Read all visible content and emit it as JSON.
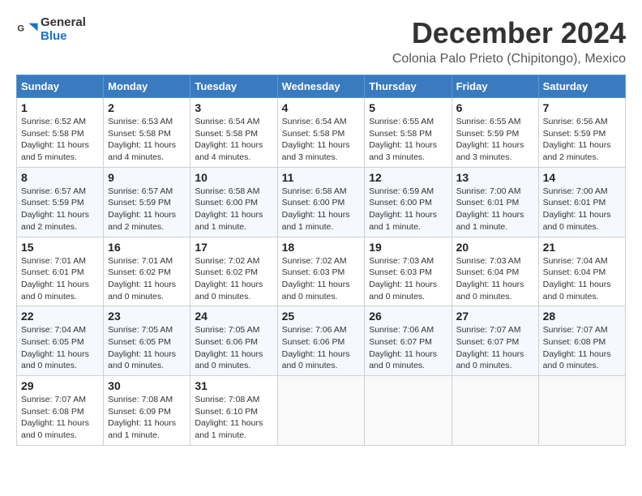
{
  "logo": {
    "text_general": "General",
    "text_blue": "Blue"
  },
  "title": {
    "month": "December 2024",
    "location": "Colonia Palo Prieto (Chipitongo), Mexico"
  },
  "weekdays": [
    "Sunday",
    "Monday",
    "Tuesday",
    "Wednesday",
    "Thursday",
    "Friday",
    "Saturday"
  ],
  "weeks": [
    [
      {
        "day": "1",
        "info": "Sunrise: 6:52 AM\nSunset: 5:58 PM\nDaylight: 11 hours and 5 minutes."
      },
      {
        "day": "2",
        "info": "Sunrise: 6:53 AM\nSunset: 5:58 PM\nDaylight: 11 hours and 4 minutes."
      },
      {
        "day": "3",
        "info": "Sunrise: 6:54 AM\nSunset: 5:58 PM\nDaylight: 11 hours and 4 minutes."
      },
      {
        "day": "4",
        "info": "Sunrise: 6:54 AM\nSunset: 5:58 PM\nDaylight: 11 hours and 3 minutes."
      },
      {
        "day": "5",
        "info": "Sunrise: 6:55 AM\nSunset: 5:58 PM\nDaylight: 11 hours and 3 minutes."
      },
      {
        "day": "6",
        "info": "Sunrise: 6:55 AM\nSunset: 5:59 PM\nDaylight: 11 hours and 3 minutes."
      },
      {
        "day": "7",
        "info": "Sunrise: 6:56 AM\nSunset: 5:59 PM\nDaylight: 11 hours and 2 minutes."
      }
    ],
    [
      {
        "day": "8",
        "info": "Sunrise: 6:57 AM\nSunset: 5:59 PM\nDaylight: 11 hours and 2 minutes."
      },
      {
        "day": "9",
        "info": "Sunrise: 6:57 AM\nSunset: 5:59 PM\nDaylight: 11 hours and 2 minutes."
      },
      {
        "day": "10",
        "info": "Sunrise: 6:58 AM\nSunset: 6:00 PM\nDaylight: 11 hours and 1 minute."
      },
      {
        "day": "11",
        "info": "Sunrise: 6:58 AM\nSunset: 6:00 PM\nDaylight: 11 hours and 1 minute."
      },
      {
        "day": "12",
        "info": "Sunrise: 6:59 AM\nSunset: 6:00 PM\nDaylight: 11 hours and 1 minute."
      },
      {
        "day": "13",
        "info": "Sunrise: 7:00 AM\nSunset: 6:01 PM\nDaylight: 11 hours and 1 minute."
      },
      {
        "day": "14",
        "info": "Sunrise: 7:00 AM\nSunset: 6:01 PM\nDaylight: 11 hours and 0 minutes."
      }
    ],
    [
      {
        "day": "15",
        "info": "Sunrise: 7:01 AM\nSunset: 6:01 PM\nDaylight: 11 hours and 0 minutes."
      },
      {
        "day": "16",
        "info": "Sunrise: 7:01 AM\nSunset: 6:02 PM\nDaylight: 11 hours and 0 minutes."
      },
      {
        "day": "17",
        "info": "Sunrise: 7:02 AM\nSunset: 6:02 PM\nDaylight: 11 hours and 0 minutes."
      },
      {
        "day": "18",
        "info": "Sunrise: 7:02 AM\nSunset: 6:03 PM\nDaylight: 11 hours and 0 minutes."
      },
      {
        "day": "19",
        "info": "Sunrise: 7:03 AM\nSunset: 6:03 PM\nDaylight: 11 hours and 0 minutes."
      },
      {
        "day": "20",
        "info": "Sunrise: 7:03 AM\nSunset: 6:04 PM\nDaylight: 11 hours and 0 minutes."
      },
      {
        "day": "21",
        "info": "Sunrise: 7:04 AM\nSunset: 6:04 PM\nDaylight: 11 hours and 0 minutes."
      }
    ],
    [
      {
        "day": "22",
        "info": "Sunrise: 7:04 AM\nSunset: 6:05 PM\nDaylight: 11 hours and 0 minutes."
      },
      {
        "day": "23",
        "info": "Sunrise: 7:05 AM\nSunset: 6:05 PM\nDaylight: 11 hours and 0 minutes."
      },
      {
        "day": "24",
        "info": "Sunrise: 7:05 AM\nSunset: 6:06 PM\nDaylight: 11 hours and 0 minutes."
      },
      {
        "day": "25",
        "info": "Sunrise: 7:06 AM\nSunset: 6:06 PM\nDaylight: 11 hours and 0 minutes."
      },
      {
        "day": "26",
        "info": "Sunrise: 7:06 AM\nSunset: 6:07 PM\nDaylight: 11 hours and 0 minutes."
      },
      {
        "day": "27",
        "info": "Sunrise: 7:07 AM\nSunset: 6:07 PM\nDaylight: 11 hours and 0 minutes."
      },
      {
        "day": "28",
        "info": "Sunrise: 7:07 AM\nSunset: 6:08 PM\nDaylight: 11 hours and 0 minutes."
      }
    ],
    [
      {
        "day": "29",
        "info": "Sunrise: 7:07 AM\nSunset: 6:08 PM\nDaylight: 11 hours and 0 minutes."
      },
      {
        "day": "30",
        "info": "Sunrise: 7:08 AM\nSunset: 6:09 PM\nDaylight: 11 hours and 1 minute."
      },
      {
        "day": "31",
        "info": "Sunrise: 7:08 AM\nSunset: 6:10 PM\nDaylight: 11 hours and 1 minute."
      },
      null,
      null,
      null,
      null
    ]
  ]
}
